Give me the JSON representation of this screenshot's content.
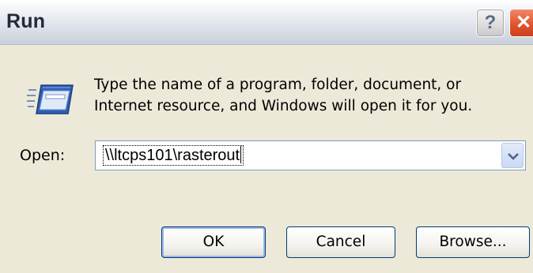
{
  "window": {
    "title": "Run",
    "help_glyph": "?",
    "close_glyph": "✕"
  },
  "icon": {
    "name": "run-program-icon"
  },
  "description": {
    "line1": "Type the name of a program, folder, document, or",
    "line2": "Internet resource, and Windows will open it for you."
  },
  "open": {
    "label": "Open:",
    "value": "\\\\ltcps101\\rasterout"
  },
  "buttons": {
    "ok": "OK",
    "cancel": "Cancel",
    "browse": "Browse..."
  },
  "colors": {
    "dialog_bg": "#ece9d8",
    "close_button": "#e0552e",
    "button_border": "#003c74",
    "focus_ring": "#9cb8ef"
  }
}
